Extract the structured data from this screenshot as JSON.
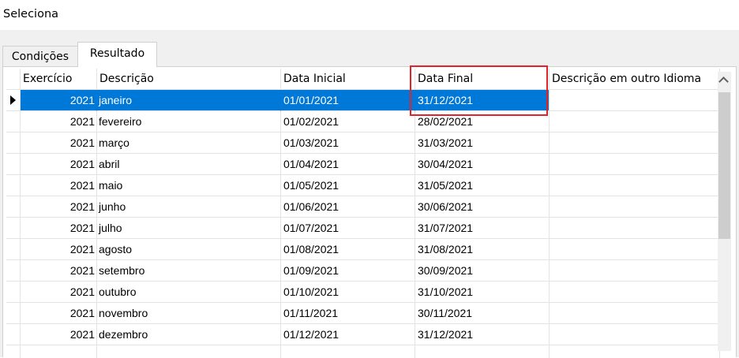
{
  "window": {
    "title": "Seleciona"
  },
  "tabs": [
    {
      "label": "Condições",
      "active": false
    },
    {
      "label": "Resultado",
      "active": true
    }
  ],
  "table": {
    "columns": [
      "Exercício",
      "Descrição",
      "Data Inicial",
      "Data Final",
      "Descrição em outro Idioma"
    ],
    "rows": [
      {
        "exercicio": "2021",
        "descricao": "janeiro",
        "data_inicial": "01/01/2021",
        "data_final": "31/12/2021",
        "outro_idioma": ""
      },
      {
        "exercicio": "2021",
        "descricao": "fevereiro",
        "data_inicial": "01/02/2021",
        "data_final": "28/02/2021",
        "outro_idioma": ""
      },
      {
        "exercicio": "2021",
        "descricao": "março",
        "data_inicial": "01/03/2021",
        "data_final": "31/03/2021",
        "outro_idioma": ""
      },
      {
        "exercicio": "2021",
        "descricao": "abril",
        "data_inicial": "01/04/2021",
        "data_final": "30/04/2021",
        "outro_idioma": ""
      },
      {
        "exercicio": "2021",
        "descricao": "maio",
        "data_inicial": "01/05/2021",
        "data_final": "31/05/2021",
        "outro_idioma": ""
      },
      {
        "exercicio": "2021",
        "descricao": "junho",
        "data_inicial": "01/06/2021",
        "data_final": "30/06/2021",
        "outro_idioma": ""
      },
      {
        "exercicio": "2021",
        "descricao": "julho",
        "data_inicial": "01/07/2021",
        "data_final": "31/07/2021",
        "outro_idioma": ""
      },
      {
        "exercicio": "2021",
        "descricao": "agosto",
        "data_inicial": "01/08/2021",
        "data_final": "31/08/2021",
        "outro_idioma": ""
      },
      {
        "exercicio": "2021",
        "descricao": "setembro",
        "data_inicial": "01/09/2021",
        "data_final": "30/09/2021",
        "outro_idioma": ""
      },
      {
        "exercicio": "2021",
        "descricao": "outubro",
        "data_inicial": "01/10/2021",
        "data_final": "31/10/2021",
        "outro_idioma": ""
      },
      {
        "exercicio": "2021",
        "descricao": "novembro",
        "data_inicial": "01/11/2021",
        "data_final": "30/11/2021",
        "outro_idioma": ""
      },
      {
        "exercicio": "2021",
        "descricao": "dezembro",
        "data_inicial": "01/12/2021",
        "data_final": "31/12/2021",
        "outro_idioma": ""
      }
    ]
  },
  "colors": {
    "selection": "#0078d7",
    "highlight_box": "#e0242b",
    "scrollbar_thumb": "#cdcdcd"
  },
  "icons": {
    "row_indicator": "current-row-arrow-icon",
    "scroll_up": "chevron-up-icon"
  }
}
